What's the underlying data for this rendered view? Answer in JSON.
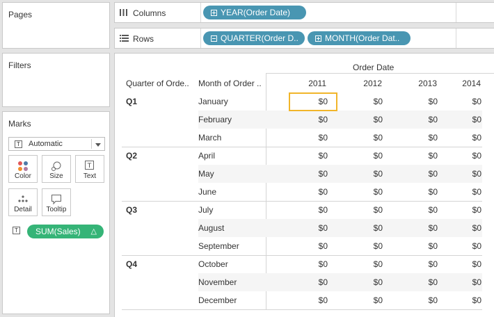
{
  "panels": {
    "pages_title": "Pages",
    "filters_title": "Filters",
    "marks_title": "Marks"
  },
  "marks": {
    "type_label": "Automatic",
    "buttons": [
      {
        "label": "Color",
        "icon": "color-icon"
      },
      {
        "label": "Size",
        "icon": "size-icon"
      },
      {
        "label": "Text",
        "icon": "text-icon"
      },
      {
        "label": "Detail",
        "icon": "detail-icon"
      },
      {
        "label": "Tooltip",
        "icon": "tooltip-icon"
      }
    ],
    "field_pill": "SUM(Sales)",
    "field_pill_delta": "△"
  },
  "shelves": {
    "columns_label": "Columns",
    "rows_label": "Rows",
    "columns_pills": [
      "YEAR(Order Date)"
    ],
    "rows_pills": [
      "QUARTER(Order D..",
      "MONTH(Order Dat.."
    ]
  },
  "table": {
    "column_group_header": "Order Date",
    "row_header_1": "Quarter of Orde..",
    "row_header_2": "Month of Order ..",
    "years": [
      "2011",
      "2012",
      "2013",
      "2014"
    ],
    "quarters": [
      {
        "label": "Q1",
        "months": [
          "January",
          "February",
          "March"
        ]
      },
      {
        "label": "Q2",
        "months": [
          "April",
          "May",
          "June"
        ]
      },
      {
        "label": "Q3",
        "months": [
          "July",
          "August",
          "September"
        ]
      },
      {
        "label": "Q4",
        "months": [
          "October",
          "November",
          "December"
        ]
      }
    ],
    "cell_value": "$0"
  },
  "colors": {
    "dimension_pill": "#4996b2",
    "measure_pill": "#35b477",
    "selection": "#f1b52a"
  }
}
